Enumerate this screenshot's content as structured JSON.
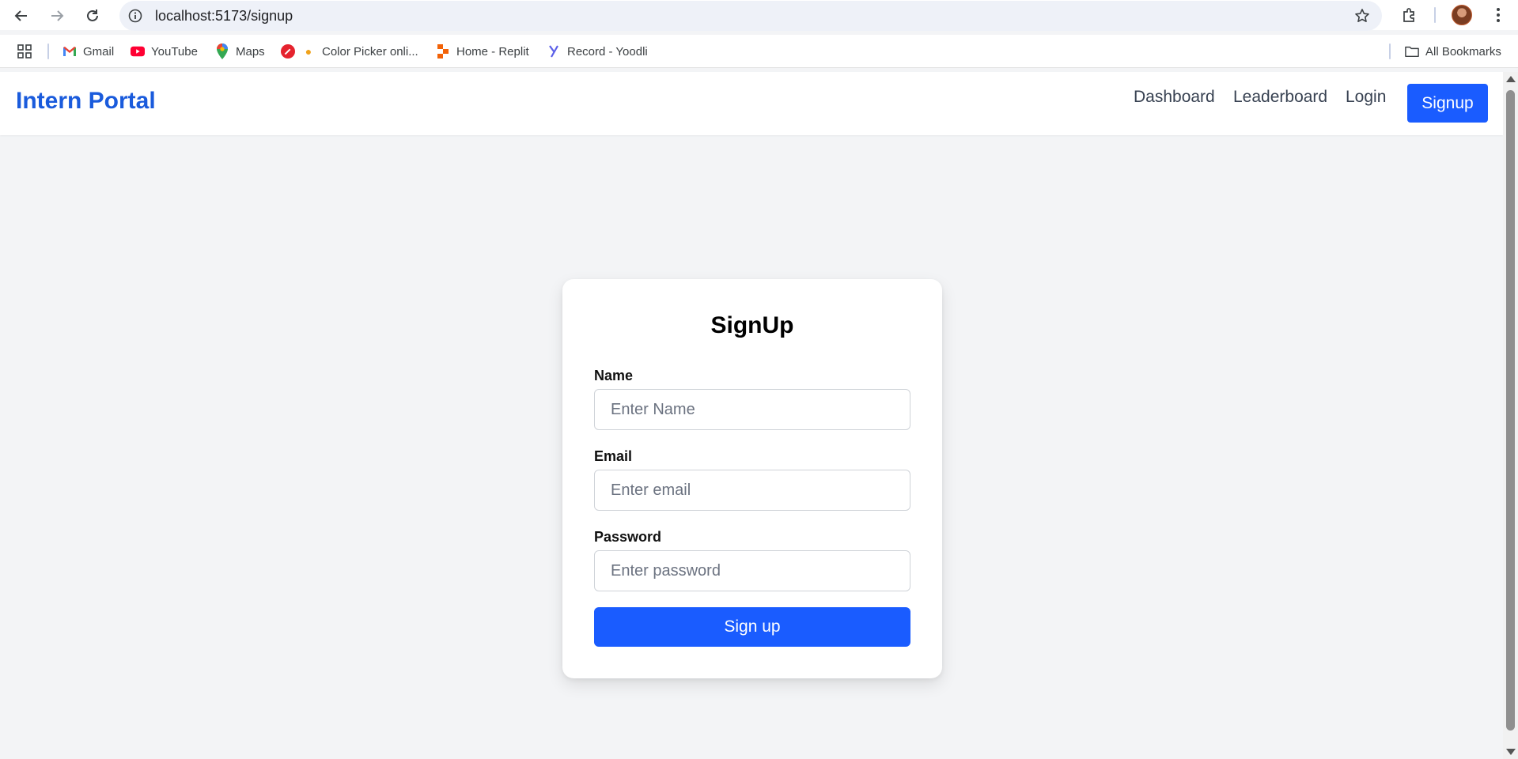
{
  "browser": {
    "url": "localhost:5173/signup",
    "bookmarks": [
      {
        "label": "Gmail",
        "icon": "gmail-icon"
      },
      {
        "label": "YouTube",
        "icon": "youtube-icon"
      },
      {
        "label": "Maps",
        "icon": "maps-icon"
      },
      {
        "label": "Color Picker onli...",
        "icon": "color-picker-icon"
      },
      {
        "label": "Home - Replit",
        "icon": "replit-icon"
      },
      {
        "label": "Record - Yoodli",
        "icon": "yoodli-icon"
      }
    ],
    "all_bookmarks": "All Bookmarks"
  },
  "navbar": {
    "brand": "Intern Portal",
    "links": [
      "Dashboard",
      "Leaderboard",
      "Login"
    ],
    "signup": "Signup"
  },
  "form": {
    "title": "SignUp",
    "name_label": "Name",
    "name_placeholder": "Enter Name",
    "email_label": "Email",
    "email_placeholder": "Enter email",
    "password_label": "Password",
    "password_placeholder": "Enter password",
    "submit": "Sign up"
  },
  "colors": {
    "brand": "#1a5bdc",
    "primary_button": "#1a5cff",
    "page_background": "#f3f4f6"
  }
}
